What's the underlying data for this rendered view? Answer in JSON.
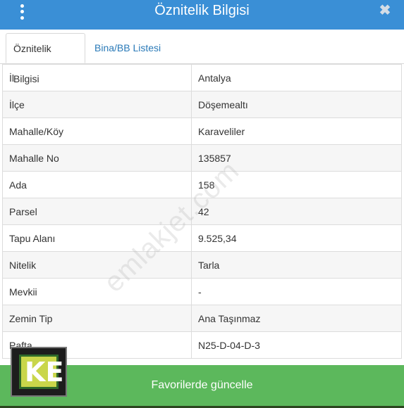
{
  "header": {
    "title": "Öznitelik Bilgisi",
    "menu_icon": "vertical-dots-icon",
    "close_icon": "close-icon",
    "close_glyph": "✖"
  },
  "tabs": [
    {
      "label": "Öznitelik Bilgisi",
      "active": true
    },
    {
      "label": "Bina/BB Listesi",
      "active": false
    }
  ],
  "attributes": [
    {
      "key": "İl",
      "value": "Antalya"
    },
    {
      "key": "İlçe",
      "value": "Döşemealtı"
    },
    {
      "key": "Mahalle/Köy",
      "value": "Karaveliler"
    },
    {
      "key": "Mahalle No",
      "value": "135857"
    },
    {
      "key": "Ada",
      "value": "158"
    },
    {
      "key": "Parsel",
      "value": "42"
    },
    {
      "key": "Tapu Alanı",
      "value": "9.525,34"
    },
    {
      "key": "Nitelik",
      "value": "Tarla"
    },
    {
      "key": "Mevkii",
      "value": "-"
    },
    {
      "key": "Zemin Tip",
      "value": "Ana Taşınmaz"
    },
    {
      "key": "Pafta",
      "value": "N25-D-04-D-3"
    }
  ],
  "footer": {
    "button_label": "Favorilerde güncelle"
  },
  "watermark": {
    "text": "emlakjet.com"
  },
  "logo": {
    "text": "KE"
  },
  "colors": {
    "header": "#3a8fd6",
    "button": "#5cb85c",
    "link": "#2a7ab8"
  }
}
